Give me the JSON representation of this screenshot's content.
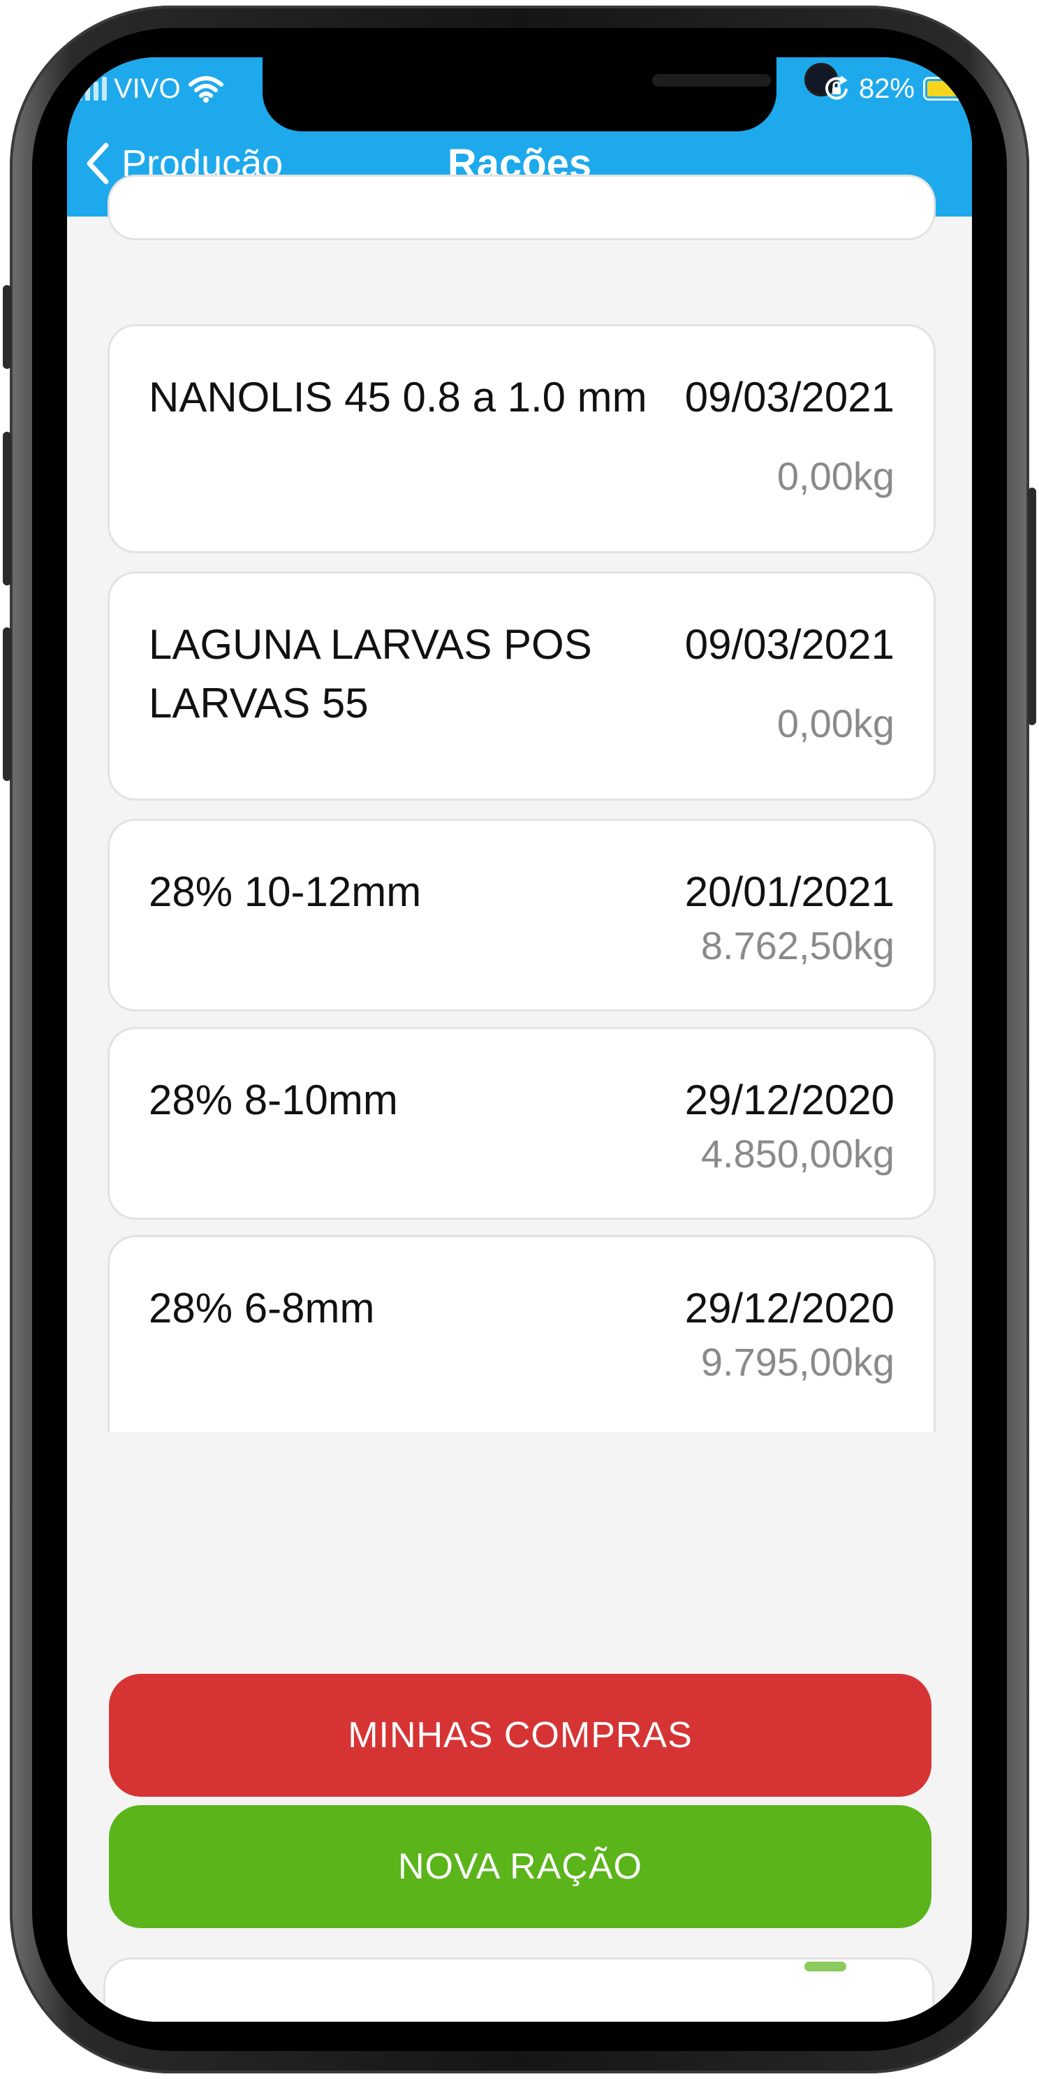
{
  "status_bar": {
    "carrier": "VIVO",
    "battery_percent": "82%",
    "battery_level": 0.82
  },
  "header": {
    "back_label": "Produção",
    "title": "Rações",
    "background_color": "#1ea9ec"
  },
  "feeds": [
    {
      "name": "NANOLIS 45 0.8 a 1.0 mm",
      "date": "09/03/2021",
      "weight": "0,00kg"
    },
    {
      "name": "LAGUNA LARVAS POS LARVAS 55",
      "date": "09/03/2021",
      "weight": "0,00kg"
    },
    {
      "name": "28% 10-12mm",
      "date": "20/01/2021",
      "weight": "8.762,50kg"
    },
    {
      "name": "28% 8-10mm",
      "date": "29/12/2020",
      "weight": "4.850,00kg"
    },
    {
      "name": "28% 6-8mm",
      "date": "29/12/2020",
      "weight": "9.795,00kg"
    }
  ],
  "actions": {
    "purchases_label": "MINHAS COMPRAS",
    "purchases_color": "#d63434",
    "new_feed_label": "NOVA RAÇÃO",
    "new_feed_color": "#5ab41a"
  },
  "icons": [
    "wifi-icon",
    "signal-icon",
    "rotation-lock-icon",
    "battery-icon",
    "chevron-left-icon"
  ]
}
